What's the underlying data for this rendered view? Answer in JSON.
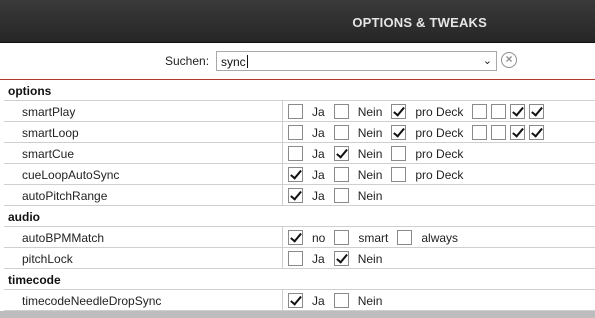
{
  "header": {
    "title": "OPTIONS & TWEAKS"
  },
  "search": {
    "label": "Suchen:",
    "value": "sync"
  },
  "sections": [
    {
      "title": "options",
      "rows": [
        {
          "name": "smartPlay",
          "options": [
            {
              "label": "Ja",
              "checked": false
            },
            {
              "label": "Nein",
              "checked": false
            },
            {
              "label": "pro Deck",
              "checked": true
            }
          ],
          "decks": [
            false,
            false,
            true,
            true
          ]
        },
        {
          "name": "smartLoop",
          "options": [
            {
              "label": "Ja",
              "checked": false
            },
            {
              "label": "Nein",
              "checked": false
            },
            {
              "label": "pro Deck",
              "checked": true
            }
          ],
          "decks": [
            false,
            false,
            true,
            true
          ]
        },
        {
          "name": "smartCue",
          "options": [
            {
              "label": "Ja",
              "checked": false
            },
            {
              "label": "Nein",
              "checked": true
            },
            {
              "label": "pro Deck",
              "checked": false
            }
          ]
        },
        {
          "name": "cueLoopAutoSync",
          "options": [
            {
              "label": "Ja",
              "checked": true
            },
            {
              "label": "Nein",
              "checked": false
            },
            {
              "label": "pro Deck",
              "checked": false
            }
          ]
        },
        {
          "name": "autoPitchRange",
          "options": [
            {
              "label": "Ja",
              "checked": true
            },
            {
              "label": "Nein",
              "checked": false
            }
          ]
        }
      ]
    },
    {
      "title": "audio",
      "rows": [
        {
          "name": "autoBPMMatch",
          "options": [
            {
              "label": "no",
              "checked": true
            },
            {
              "label": "smart",
              "checked": false
            },
            {
              "label": "always",
              "checked": false
            }
          ]
        },
        {
          "name": "pitchLock",
          "options": [
            {
              "label": "Ja",
              "checked": false
            },
            {
              "label": "Nein",
              "checked": true
            }
          ]
        }
      ]
    },
    {
      "title": "timecode",
      "rows": [
        {
          "name": "timecodeNeedleDropSync",
          "options": [
            {
              "label": "Ja",
              "checked": true
            },
            {
              "label": "Nein",
              "checked": false
            }
          ]
        }
      ]
    }
  ]
}
